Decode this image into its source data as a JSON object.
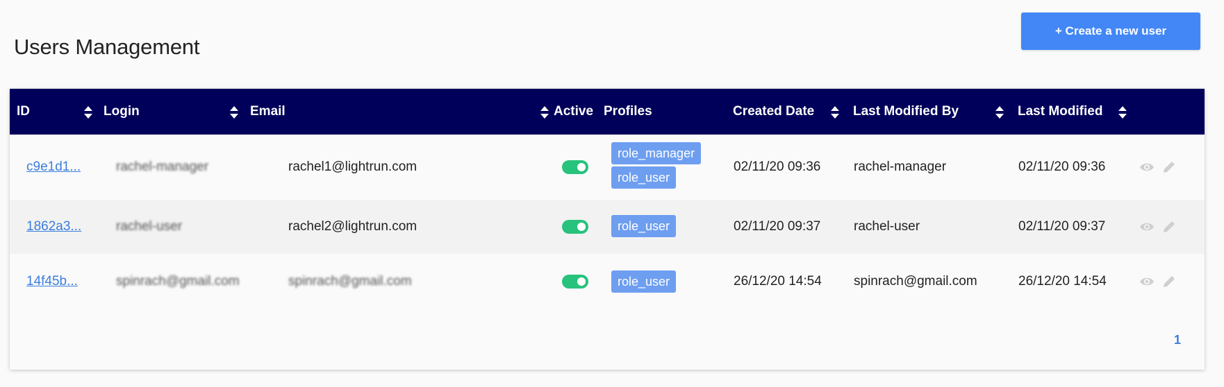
{
  "page": {
    "title": "Users Management",
    "create_button": "+ Create a new user"
  },
  "table": {
    "columns": [
      "ID",
      "Login",
      "Email",
      "Active",
      "Profiles",
      "Created Date",
      "Last Modified By",
      "Last Modified"
    ],
    "rows": [
      {
        "id": "c9e1d1...",
        "login": "rachel-manager",
        "email": "rachel1@lightrun.com",
        "active": true,
        "profiles": [
          "role_manager",
          "role_user"
        ],
        "created_date": "02/11/20 09:36",
        "last_modified_by": "rachel-manager",
        "last_modified": "02/11/20 09:36"
      },
      {
        "id": "1862a3...",
        "login": "rachel-user",
        "email": "rachel2@lightrun.com",
        "active": true,
        "profiles": [
          "role_user"
        ],
        "created_date": "02/11/20 09:37",
        "last_modified_by": "rachel-user",
        "last_modified": "02/11/20 09:37"
      },
      {
        "id": "14f45b...",
        "login": "spinrach@gmail.com",
        "email": "spinrach@gmail.com",
        "active": true,
        "profiles": [
          "role_user"
        ],
        "created_date": "26/12/20 14:54",
        "last_modified_by": "spinrach@gmail.com",
        "last_modified": "26/12/20 14:54"
      }
    ]
  },
  "pagination": {
    "current_page": "1"
  },
  "colors": {
    "header_bg": "#00005a",
    "primary": "#4287f5",
    "tag": "#6d9ef0",
    "toggle_on": "#27c27c",
    "link": "#3b7ddd"
  },
  "icons": {
    "sort": "sort-icon",
    "view": "eye-icon",
    "edit": "pencil-icon"
  }
}
